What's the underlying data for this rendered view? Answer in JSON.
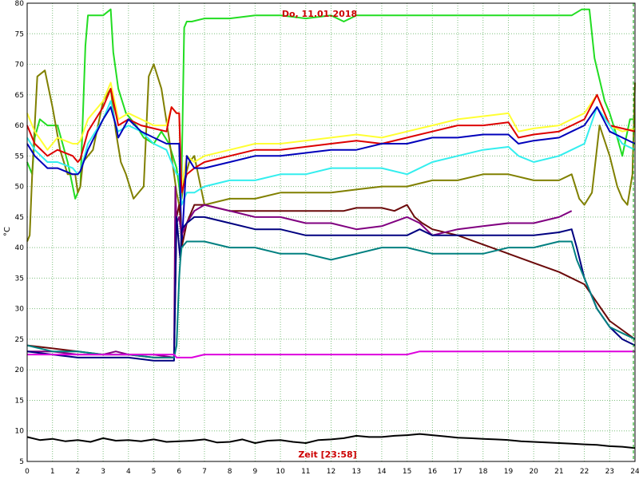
{
  "chart_data": {
    "type": "line",
    "title": "Do, 11.01.2018",
    "xlabel": "Zeit [23:58]",
    "ylabel": "°C",
    "xlim": [
      0,
      24
    ],
    "ylim": [
      5,
      80
    ],
    "xticks": [
      "0",
      "1",
      "2",
      "3",
      "4",
      "5",
      "6",
      "7",
      "8",
      "9",
      "10",
      "11",
      "12",
      "13",
      "14",
      "15",
      "16",
      "17",
      "18",
      "19",
      "20",
      "21",
      "22",
      "23",
      "24"
    ],
    "yticks": [
      "5",
      "10",
      "15",
      "20",
      "25",
      "30",
      "35",
      "40",
      "45",
      "50",
      "55",
      "60",
      "65",
      "70",
      "75",
      "80"
    ],
    "grid": true,
    "colors": {
      "grid": "#7fbf7f",
      "plot_border": "#000000",
      "title": "#cc0000",
      "end_marker": "#00a000"
    },
    "series": [
      {
        "color": "#22dd22",
        "x": [
          0,
          0.2,
          0.3,
          0.5,
          0.8,
          1.2,
          1.6,
          1.9,
          2.1,
          2.3,
          2.4,
          2.6,
          3.0,
          3.3,
          3.4,
          3.6,
          3.9,
          4.1,
          4.3,
          4.6,
          5.0,
          5.3,
          5.6,
          5.9,
          6.0,
          6.05,
          6.1,
          6.2,
          6.3,
          6.5,
          7,
          8,
          9,
          10,
          11,
          12,
          12.5,
          13,
          14,
          15,
          16,
          17,
          18,
          19,
          20,
          21,
          21.5,
          21.9,
          22.0,
          22.2,
          22.4,
          22.8,
          23.0,
          23.3,
          23.5,
          23.8,
          24
        ],
        "y": [
          54,
          52,
          58,
          61,
          60,
          60,
          54,
          48,
          50,
          73,
          78,
          78,
          78,
          79,
          72,
          66,
          62,
          61,
          60,
          58,
          57,
          59,
          57,
          53,
          50,
          48,
          52,
          76,
          77,
          77,
          77.5,
          77.5,
          78,
          78,
          77.5,
          78,
          77,
          78,
          78,
          78,
          78,
          78,
          78,
          78,
          78,
          78,
          78,
          79,
          79,
          79,
          71,
          64,
          62,
          58,
          55,
          61,
          61
        ]
      },
      {
        "color": "#808000",
        "x": [
          0,
          0.1,
          0.2,
          0.4,
          0.7,
          1.0,
          1.3,
          1.6,
          1.9,
          2.0,
          2.1,
          2.2,
          2.6,
          3.0,
          3.3,
          3.5,
          3.7,
          3.9,
          4.2,
          4.6,
          4.8,
          5.0,
          5.3,
          5.6,
          5.9,
          6.0,
          6.1,
          6.2,
          6.4,
          6.6,
          7,
          8,
          9,
          10,
          11,
          12,
          13,
          14,
          15,
          16,
          17,
          18,
          19,
          20,
          21,
          21.5,
          21.8,
          22.0,
          22.3,
          22.6,
          23.0,
          23.3,
          23.5,
          23.7,
          23.9,
          24
        ],
        "y": [
          41,
          42,
          52,
          68,
          69,
          63,
          56,
          52,
          52,
          49,
          50,
          54,
          56,
          64,
          66,
          59,
          54,
          52,
          48,
          50,
          68,
          70,
          66,
          58,
          49,
          47,
          48,
          51,
          54,
          55,
          47,
          48,
          48,
          49,
          49,
          49,
          49.5,
          50,
          50,
          51,
          51,
          52,
          52,
          51,
          51,
          52,
          48,
          47,
          49,
          60,
          55,
          50,
          48,
          47,
          52,
          67
        ]
      },
      {
        "color": "#ffff33",
        "x": [
          0,
          0.3,
          0.8,
          1.2,
          1.8,
          2.0,
          2.1,
          2.4,
          3.0,
          3.3,
          3.5,
          3.6,
          4.0,
          4.5,
          5.0,
          5.5,
          5.7,
          5.9,
          6.0,
          6.1,
          6.3,
          6.6,
          7,
          8,
          9,
          10,
          11,
          12,
          13,
          14,
          15,
          16,
          17,
          18,
          19,
          19.4,
          20,
          21,
          21.5,
          22,
          22.5,
          23,
          23.5,
          24
        ],
        "y": [
          62,
          59,
          56,
          58,
          57,
          57,
          57.5,
          61,
          64,
          67,
          63,
          61,
          62,
          61,
          60,
          60,
          63,
          62,
          62,
          50,
          55,
          54,
          55,
          56,
          57,
          57,
          57.5,
          58,
          58.5,
          58,
          59,
          60,
          61,
          61.5,
          62,
          59,
          59.5,
          60,
          61,
          62,
          65,
          60,
          59,
          59.5
        ]
      },
      {
        "color": "#dd0000",
        "x": [
          0,
          0.3,
          0.8,
          1.2,
          1.8,
          2.0,
          2.1,
          2.4,
          3.0,
          3.3,
          3.5,
          3.6,
          4.0,
          4.5,
          5.0,
          5.5,
          5.7,
          5.9,
          6.0,
          6.1,
          6.3,
          6.6,
          7,
          8,
          9,
          10,
          11,
          12,
          13,
          14,
          15,
          16,
          17,
          18,
          19,
          19.4,
          20,
          21,
          21.5,
          22,
          22.5,
          23,
          23.5,
          24
        ],
        "y": [
          60,
          57,
          55,
          56,
          55,
          54,
          54.5,
          59,
          63,
          66,
          62,
          60,
          61,
          60,
          59.5,
          59,
          63,
          62,
          62,
          49,
          52,
          53,
          54,
          55,
          56,
          56,
          56.5,
          57,
          57.5,
          57,
          58,
          59,
          60,
          60,
          60.5,
          58,
          58.5,
          59,
          60,
          61,
          65,
          60,
          59.5,
          59
        ]
      },
      {
        "color": "#33eeee",
        "x": [
          0,
          0.3,
          0.8,
          1.2,
          1.8,
          2.0,
          2.1,
          2.4,
          3.0,
          3.3,
          3.5,
          3.6,
          4.0,
          4.5,
          5.0,
          5.5,
          5.7,
          5.9,
          6.0,
          6.1,
          6.3,
          6.6,
          7,
          8,
          9,
          10,
          11,
          12,
          13,
          14,
          15,
          16,
          17,
          18,
          19,
          19.4,
          20,
          21,
          21.5,
          22,
          22.5,
          23,
          23.5,
          24
        ],
        "y": [
          58,
          56,
          54,
          54,
          53,
          52,
          52.5,
          57,
          61,
          64,
          60,
          59,
          60,
          59,
          57,
          56,
          54,
          52,
          52,
          47,
          49,
          49,
          50,
          51,
          51,
          52,
          52,
          53,
          53,
          53,
          52,
          54,
          55,
          56,
          56.5,
          55,
          54,
          55,
          56,
          57,
          63,
          60,
          57,
          56
        ]
      },
      {
        "color": "#0000bb",
        "x": [
          0,
          0.3,
          0.8,
          1.2,
          1.8,
          2.0,
          2.1,
          2.4,
          3.0,
          3.3,
          3.5,
          3.6,
          4.0,
          4.5,
          5.0,
          5.5,
          5.7,
          5.9,
          6.0,
          6.1,
          6.3,
          6.6,
          7,
          8,
          9,
          10,
          11,
          12,
          13,
          14,
          15,
          16,
          17,
          18,
          19,
          19.4,
          20,
          21,
          21.5,
          22,
          22.5,
          23,
          23.5,
          24
        ],
        "y": [
          57,
          55,
          53,
          53,
          52,
          52,
          52.5,
          56,
          61,
          63,
          60,
          58,
          61,
          59,
          58,
          57,
          57,
          57,
          57,
          40,
          55,
          53,
          53,
          54,
          55,
          55,
          55.5,
          56,
          56,
          57,
          57,
          58,
          58,
          58.5,
          58.5,
          57,
          57.5,
          58,
          59,
          60,
          63,
          59,
          58,
          57
        ]
      },
      {
        "color": "#6b0a0a",
        "x": [
          0,
          1,
          2,
          3,
          4,
          5,
          5.8,
          5.9,
          6.0,
          6.05,
          6.1,
          6.3,
          6.6,
          7,
          8,
          9,
          10,
          11,
          12,
          12.5,
          13,
          14,
          14.5,
          15,
          15.3,
          15.6,
          16,
          17,
          18,
          19,
          20,
          21,
          22,
          23,
          24
        ],
        "y": [
          24,
          23.5,
          23,
          22.5,
          22.5,
          22,
          22,
          45,
          47,
          45,
          40,
          44,
          47,
          47,
          46,
          46,
          46,
          46,
          46,
          46,
          46.5,
          46.5,
          46,
          47,
          45,
          44,
          43,
          42,
          40.5,
          39,
          37.5,
          36,
          34,
          28,
          25
        ]
      },
      {
        "color": "#800080",
        "x": [
          0,
          1,
          2,
          3,
          3.5,
          4,
          5,
          5.8,
          5.85,
          5.9,
          6.0,
          6.1,
          6.3,
          6.6,
          7,
          8,
          9,
          10,
          11,
          12,
          13,
          14,
          15,
          15.5,
          16,
          17,
          18,
          19,
          20,
          21,
          21.5
        ],
        "y": [
          23,
          23,
          22.5,
          22.5,
          23,
          22.5,
          22.5,
          22,
          50,
          44,
          45,
          42,
          44,
          46,
          47,
          46,
          45,
          45,
          44,
          44,
          43,
          43.5,
          45,
          44,
          42,
          43,
          43.5,
          44,
          44,
          45,
          46
        ]
      },
      {
        "color": "#000080",
        "x": [
          0,
          1,
          2,
          3,
          4,
          5,
          5.8,
          5.9,
          6.0,
          6.05,
          6.1,
          6.3,
          6.6,
          7,
          8,
          9,
          10,
          11,
          12,
          13,
          14,
          15,
          15.5,
          16,
          17,
          18,
          19,
          20,
          21,
          21.5,
          21.7,
          22,
          22.5,
          23,
          23.5,
          24
        ],
        "y": [
          23,
          22.5,
          22,
          22,
          22,
          21.5,
          21.5,
          45,
          40,
          38,
          43,
          44,
          45,
          45,
          44,
          43,
          43,
          42,
          42,
          42,
          42,
          42,
          43,
          42,
          42,
          42,
          42,
          42,
          42.5,
          43,
          40,
          35,
          30,
          27,
          25,
          24
        ]
      },
      {
        "color": "#008080",
        "x": [
          0,
          1,
          2,
          3,
          4,
          5,
          5.8,
          5.9,
          6.0,
          6.05,
          6.1,
          6.3,
          6.6,
          7,
          8,
          9,
          10,
          11,
          12,
          13,
          14,
          15,
          16,
          17,
          18,
          19,
          20,
          21,
          21.5,
          21.7,
          22,
          22.5,
          23,
          23.5,
          24
        ],
        "y": [
          24,
          23,
          23,
          22.5,
          22.5,
          22,
          22,
          24,
          35,
          38,
          40,
          41,
          41,
          41,
          40,
          40,
          39,
          39,
          38,
          39,
          40,
          40,
          39,
          39,
          39,
          40,
          40,
          41,
          41,
          38,
          35,
          30,
          27,
          26,
          25
        ]
      },
      {
        "color": "#dd00dd",
        "x": [
          0,
          1,
          2,
          3,
          4,
          5,
          5.8,
          5.9,
          6.0,
          6.5,
          7,
          8,
          9,
          10,
          11,
          12,
          13,
          14,
          15,
          15.5,
          16,
          17,
          18,
          19,
          20,
          21,
          21.5,
          22,
          23,
          23.5,
          24
        ],
        "y": [
          22.5,
          22.5,
          22.5,
          22.5,
          22.5,
          22.5,
          22.5,
          22,
          22,
          22,
          22.5,
          22.5,
          22.5,
          22.5,
          22.5,
          22.5,
          22.5,
          22.5,
          22.5,
          23,
          23,
          23,
          23,
          23,
          23,
          23,
          23,
          23,
          23,
          23,
          23
        ]
      },
      {
        "color": "#000000",
        "x": [
          0,
          0.5,
          1,
          1.5,
          2,
          2.5,
          3,
          3.5,
          4,
          4.5,
          5,
          5.5,
          6,
          6.5,
          7,
          7.5,
          8,
          8.5,
          9,
          9.5,
          10,
          10.5,
          11,
          11.5,
          12,
          12.5,
          13,
          13.5,
          14,
          14.5,
          15,
          15.5,
          16,
          16.5,
          17,
          17.5,
          18,
          18.5,
          19,
          19.5,
          20,
          20.5,
          21,
          21.5,
          22,
          22.5,
          23,
          23.5,
          24
        ],
        "y": [
          9,
          8.5,
          8.7,
          8.3,
          8.5,
          8.2,
          8.8,
          8.4,
          8.5,
          8.3,
          8.6,
          8.2,
          8.3,
          8.4,
          8.6,
          8.1,
          8.2,
          8.6,
          8.0,
          8.4,
          8.5,
          8.2,
          8.0,
          8.5,
          8.6,
          8.8,
          9.2,
          9.0,
          9.0,
          9.2,
          9.3,
          9.5,
          9.3,
          9.1,
          8.9,
          8.8,
          8.7,
          8.6,
          8.5,
          8.3,
          8.2,
          8.1,
          8.0,
          7.9,
          7.8,
          7.7,
          7.5,
          7.4,
          7.2
        ]
      }
    ]
  }
}
